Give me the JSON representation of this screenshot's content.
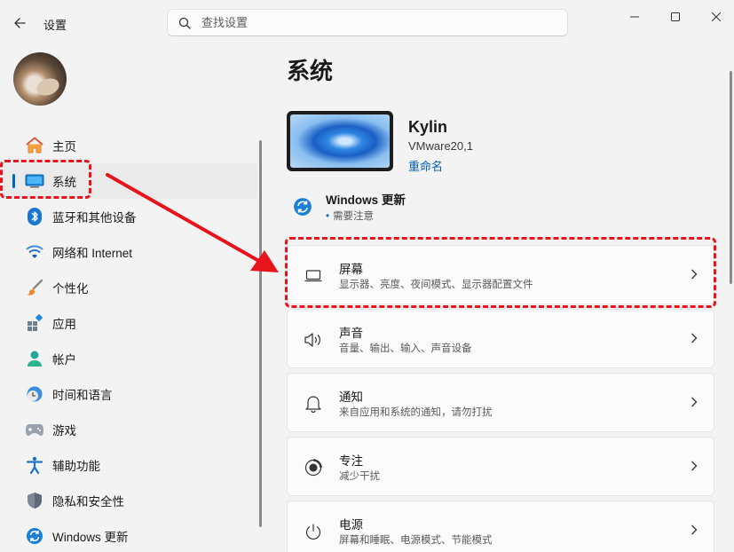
{
  "header": {
    "app_title": "设置",
    "search_placeholder": "查找设置"
  },
  "sidebar": {
    "items": [
      {
        "label": "主页",
        "icon": "home-icon"
      },
      {
        "label": "系统",
        "icon": "system-icon",
        "active": true
      },
      {
        "label": "蓝牙和其他设备",
        "icon": "bluetooth-icon"
      },
      {
        "label": "网络和 Internet",
        "icon": "wifi-icon"
      },
      {
        "label": "个性化",
        "icon": "brush-icon"
      },
      {
        "label": "应用",
        "icon": "apps-icon"
      },
      {
        "label": "帐户",
        "icon": "account-icon"
      },
      {
        "label": "时间和语言",
        "icon": "time-language-icon"
      },
      {
        "label": "游戏",
        "icon": "gamepad-icon"
      },
      {
        "label": "辅助功能",
        "icon": "accessibility-icon"
      },
      {
        "label": "隐私和安全性",
        "icon": "shield-icon"
      },
      {
        "label": "Windows 更新",
        "icon": "update-icon"
      }
    ]
  },
  "main": {
    "title": "系统",
    "device": {
      "name": "Kylin",
      "model": "VMware20,1",
      "rename": "重命名"
    },
    "windows_update": {
      "title": "Windows 更新",
      "status": "需要注意"
    },
    "cards": [
      {
        "title": "屏幕",
        "subtitle": "显示器、亮度、夜间模式、显示器配置文件",
        "icon": "display-icon"
      },
      {
        "title": "声音",
        "subtitle": "音量、输出、输入、声音设备",
        "icon": "speaker-icon"
      },
      {
        "title": "通知",
        "subtitle": "来自应用和系统的通知，请勿打扰",
        "icon": "bell-icon"
      },
      {
        "title": "专注",
        "subtitle": "减少干扰",
        "icon": "focus-icon"
      },
      {
        "title": "电源",
        "subtitle": "屏幕和睡眠、电源模式、节能模式",
        "icon": "power-icon"
      }
    ]
  },
  "colors": {
    "accent": "#0067c0",
    "annotation": "#e8141b"
  }
}
